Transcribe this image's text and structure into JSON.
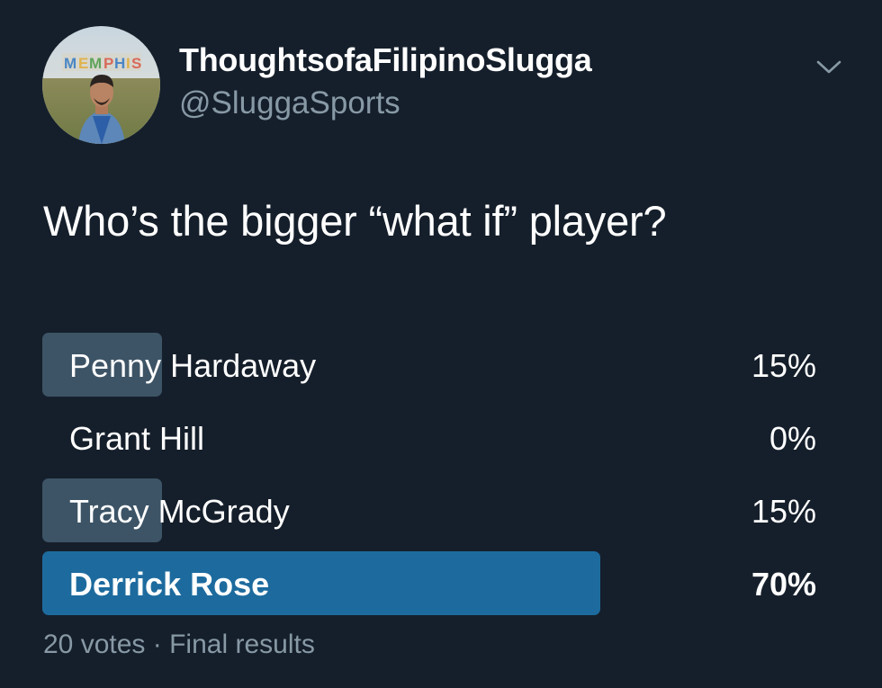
{
  "author": {
    "display_name": "ThoughtsofaFilipinoSlugga",
    "handle": "@SluggaSports",
    "avatar_sign_text": "MEMPHIS"
  },
  "menu": {
    "icon": "chevron-down-icon"
  },
  "tweet": {
    "text": "Who’s the bigger “what if” player?"
  },
  "poll": {
    "options": [
      {
        "label": "Penny Hardaway",
        "percent_text": "15%",
        "fraction": 0.15,
        "winner": false
      },
      {
        "label": "Grant Hill",
        "percent_text": "0%",
        "fraction": 0.0,
        "winner": false
      },
      {
        "label": "Tracy McGrady",
        "percent_text": "15%",
        "fraction": 0.15,
        "winner": false
      },
      {
        "label": "Derrick Rose",
        "percent_text": "70%",
        "fraction": 0.7,
        "winner": true
      }
    ],
    "votes_text": "20 votes",
    "separator": "·",
    "status_text": "Final results"
  },
  "colors": {
    "background": "#151f2b",
    "bar_default": "#3d5466",
    "bar_winner": "#1d6b9e",
    "secondary_text": "#8899a6"
  }
}
